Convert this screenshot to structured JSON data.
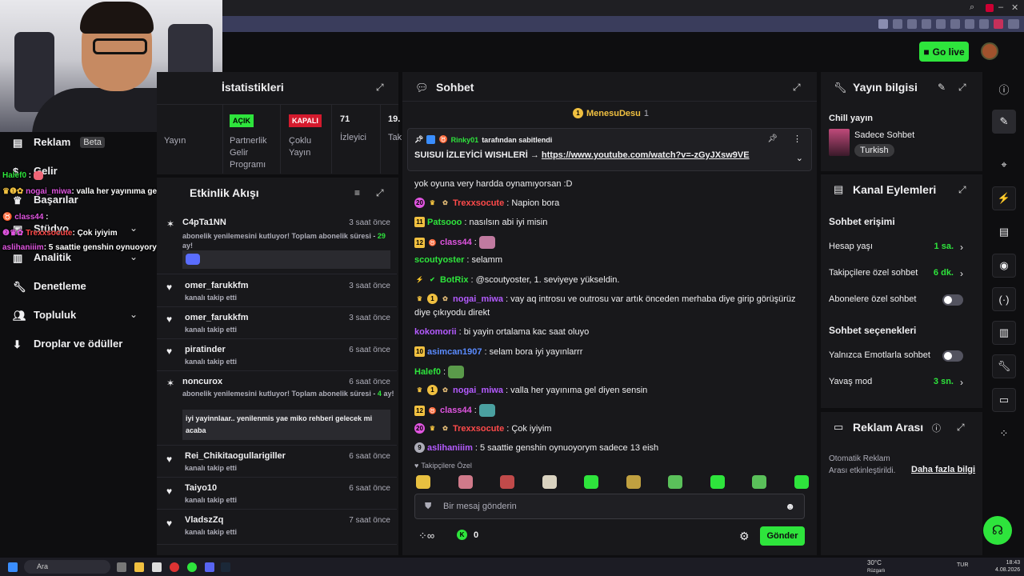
{
  "topbar": {
    "go_live": "Go live"
  },
  "leftnav": {
    "items": [
      {
        "label": "Reklam",
        "badge": "Beta"
      },
      {
        "label": "Gelir"
      },
      {
        "label": "Başarılar"
      },
      {
        "label": "Stüdyo"
      },
      {
        "label": "Analitik"
      },
      {
        "label": "Denetleme"
      },
      {
        "label": "Topluluk"
      },
      {
        "label": "Droplar ve ödüller"
      }
    ]
  },
  "overlay_chat": [
    {
      "user": "Halef0",
      "text": ":"
    },
    {
      "user": "nogai_miwa",
      "text": ": valla her yayınıma gel diyen sensin"
    },
    {
      "user": "class44",
      "text": ":"
    },
    {
      "user": "Trexxsocute",
      "text": ": Çok iyiyim"
    },
    {
      "user": "aslihaniiim",
      "text": ": 5 saattie genshin oynuoyorym sadece 13 eish"
    }
  ],
  "stats": {
    "title": "İstatistikleri",
    "cols": [
      {
        "label": "Yayın"
      },
      {
        "badge": "AÇIK",
        "label": "Partnerlik Gelir Programı"
      },
      {
        "badge": "KAPALI",
        "label": "Çoklu Yayın"
      },
      {
        "value": "71",
        "label": "İzleyici"
      },
      {
        "value": "19.",
        "label": "Tak"
      }
    ]
  },
  "feed": {
    "title": "Etkinlik Akışı",
    "items": [
      {
        "name": "C4pTa1NN",
        "time": "3 saat önce",
        "sub": "abonelik yenilemesini kutluyor! Toplam abonelik süresi - ",
        "count": "29",
        "sub2": "ay!"
      },
      {
        "name": "omer_farukkfm",
        "time": "3 saat önce",
        "sub": "kanalı takip etti"
      },
      {
        "name": "omer_farukkfm",
        "time": "3 saat önce",
        "sub": "kanalı takip etti"
      },
      {
        "name": "piratinder",
        "time": "6 saat önce",
        "sub": "kanalı takip etti"
      },
      {
        "name": "noncurox",
        "time": "6 saat önce",
        "sub": "abonelik yenilemesini kutluyor! Toplam abonelik süresi - ",
        "count": "4",
        "sub2": "ay!",
        "msg": "iyi yayinnlaar.. yenilenmis yae miko rehberi gelecek mi acaba"
      },
      {
        "name": "Rei_Chikitaogullarigiller",
        "time": "6 saat önce",
        "sub": "kanalı takip etti"
      },
      {
        "name": "Taiyo10",
        "time": "6 saat önce",
        "sub": "kanalı takip etti"
      },
      {
        "name": "VladszZq",
        "time": "7 saat önce",
        "sub": "kanalı takip etti"
      }
    ]
  },
  "chat": {
    "title": "Sohbet",
    "leader": {
      "name": "MenesuDesu",
      "count": "1"
    },
    "pinned": {
      "by": "Rinky01",
      "by_suffix": "tarafından sabitlendi",
      "text": "SUISUI İZLEYİCİ WISHLERİ → ",
      "link": "https://www.youtube.com/watch?v=-zGyJXsw9VE"
    },
    "partial_line": "yok oyuna very hardda oynamıyorsan :D",
    "messages": [
      {
        "badges": [
          "20",
          "crown",
          "gift"
        ],
        "user": "Trexxsocute",
        "color": "#ff4a4a",
        "text": ": Napion bora"
      },
      {
        "badges": [
          "11"
        ],
        "user": "Patsooo",
        "color": "#2ee43c",
        "text": ": nasılsın abi iyi misin"
      },
      {
        "badges": [
          "12",
          "cat"
        ],
        "user": "class44",
        "color": "#e055e0",
        "text": ":",
        "emote": true
      },
      {
        "badges": [],
        "user": "scoutyoster",
        "color": "#2ee43c",
        "text": ": selamm"
      },
      {
        "badges": [
          "bot",
          "check"
        ],
        "user": "BotRix",
        "color": "#2ee43c",
        "text": ": @scoutyoster, 1. seviyeye yükseldin."
      },
      {
        "badges": [
          "crown",
          "1",
          "gift"
        ],
        "user": "nogai_miwa",
        "color": "#b45bff",
        "text": ": vay aq introsu ve outrosu var artık önceden merhaba diye girip görüşürüz"
      },
      {
        "badges": [],
        "user": "",
        "color": "#efeff1",
        "text": "diye çıkıyodu direkt"
      },
      {
        "badges": [],
        "user": "kokomorii",
        "color": "#b45bff",
        "text": ": bi yayin ortalama kac saat oluyo"
      },
      {
        "badges": [
          "10"
        ],
        "user": "asimcan1907",
        "color": "#5a8bff",
        "text": ": selam bora iyi yayınlarrr"
      },
      {
        "badges": [],
        "user": "Halef0",
        "color": "#2ee43c",
        "text": ":",
        "emote": true
      },
      {
        "badges": [
          "crown",
          "1",
          "gift"
        ],
        "user": "nogai_miwa",
        "color": "#b45bff",
        "text": ": valla her yayınıma gel diyen sensin"
      },
      {
        "badges": [
          "12",
          "cat"
        ],
        "user": "class44",
        "color": "#e055e0",
        "text": ":",
        "emote": true
      },
      {
        "badges": [
          "20",
          "crown",
          "gift"
        ],
        "user": "Trexxsocute",
        "color": "#ff4a4a",
        "text": ": Çok iyiyim"
      },
      {
        "badges": [
          "9"
        ],
        "user": "aslihaniiim",
        "color": "#b45bff",
        "text": ": 5 saattie genshin oynuoyorym sadece 13 eish"
      }
    ],
    "emote_section": "Takipçilere Özel",
    "input_placeholder": "Bir mesaj gönderin",
    "points": "0",
    "send": "Gönder"
  },
  "stream_info": {
    "title": "Yayın bilgisi",
    "stream_title": "Chill yayın",
    "category": "Sadece Sohbet",
    "tag": "Turkish"
  },
  "channel_actions": {
    "title": "Kanal Eylemleri",
    "access_head": "Sohbet erişimi",
    "rows": [
      {
        "label": "Hesap yaşı",
        "value": "1 sa."
      },
      {
        "label": "Takipçilere özel sohbet",
        "value": "6 dk."
      },
      {
        "label": "Abonelere özel sohbet"
      }
    ],
    "options_head": "Sohbet seçenekleri",
    "rows2": [
      {
        "label": "Yalnızca Emotlarla sohbet"
      },
      {
        "label": "Yavaş mod",
        "value": "3 sn."
      }
    ]
  },
  "ad_break": {
    "title": "Reklam Arası",
    "text": "Otomatik Reklam Arası etkinleştirildi.",
    "link": "Daha fazla bilgi"
  },
  "taskbar": {
    "search": "Ara",
    "weather": "30°C",
    "weather_sub": "Rüzgarlı",
    "lang": "TUR",
    "time": "18:43",
    "date": "4.08.2026"
  },
  "colors": {
    "accent": "#2ee43c",
    "danger": "#d41a2d",
    "bg": "#0e0e10",
    "panel": "#18181b"
  }
}
